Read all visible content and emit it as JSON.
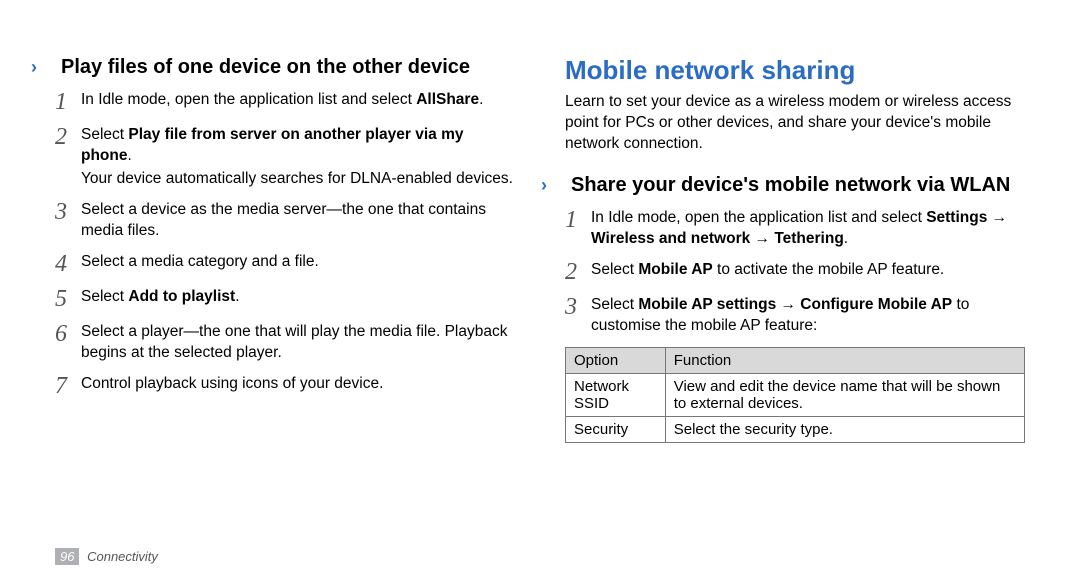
{
  "left": {
    "subhead_bullet": "›",
    "subhead": "Play files of one device on the other device",
    "steps": [
      {
        "num": "1",
        "prefix": "In Idle mode, open the application list and select ",
        "bold": "AllShare",
        "suffix": "."
      },
      {
        "num": "2",
        "prefix": "Select ",
        "bold": "Play file from server on another player via my phone",
        "suffix": ".",
        "extra": "Your device automatically searches for DLNA-enabled devices."
      },
      {
        "num": "3",
        "prefix": "Select a device as the media server—the one that contains media files.",
        "bold": "",
        "suffix": ""
      },
      {
        "num": "4",
        "prefix": "Select a media category and a file.",
        "bold": "",
        "suffix": ""
      },
      {
        "num": "5",
        "prefix": "Select ",
        "bold": "Add to playlist",
        "suffix": "."
      },
      {
        "num": "6",
        "prefix": "Select a player—the one that will play the media file. Playback begins at the selected player.",
        "bold": "",
        "suffix": ""
      },
      {
        "num": "7",
        "prefix": "Control playback using icons of your device.",
        "bold": "",
        "suffix": ""
      }
    ]
  },
  "right": {
    "main_head": "Mobile network sharing",
    "intro": "Learn to set your device as a wireless modem or wireless access point for PCs or other devices, and share your device's mobile network connection.",
    "subhead_bullet": "›",
    "subhead": "Share your device's mobile network via WLAN",
    "steps": [
      {
        "num": "1",
        "prefix": "In Idle mode, open the application list and select ",
        "bold": "Settings → Wireless and network → Tethering",
        "suffix": "."
      },
      {
        "num": "2",
        "prefix": "Select ",
        "bold": "Mobile AP",
        "suffix": " to activate the mobile AP feature."
      },
      {
        "num": "3",
        "prefix": "Select ",
        "bold": "Mobile AP settings → Configure Mobile AP",
        "suffix": " to customise the mobile AP feature:"
      }
    ],
    "table": {
      "header": {
        "col1": "Option",
        "col2": "Function"
      },
      "rows": [
        {
          "col1": "Network SSID",
          "col2": "View and edit the device name that will be shown to external devices."
        },
        {
          "col1": "Security",
          "col2": "Select the security type."
        }
      ]
    }
  },
  "footer": {
    "page_num": "96",
    "section": "Connectivity"
  }
}
